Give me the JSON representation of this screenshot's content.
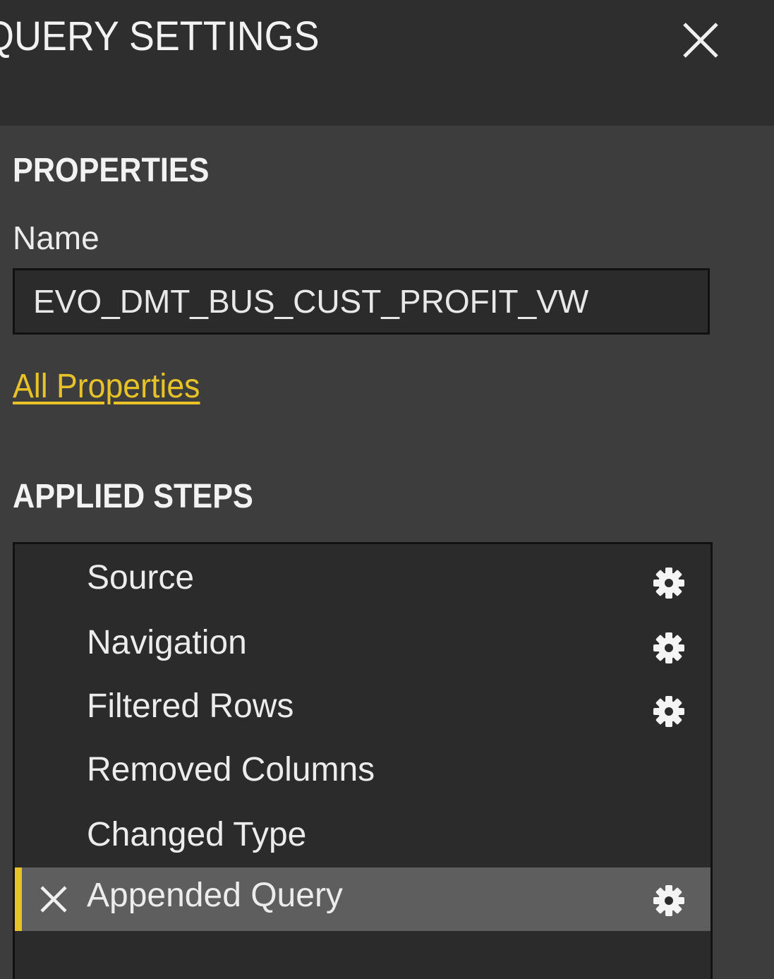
{
  "header": {
    "title": "QUERY SETTINGS",
    "close_icon": "close-icon"
  },
  "properties": {
    "section_title": "PROPERTIES",
    "name_label": "Name",
    "name_value": "EVO_DMT_BUS_CUST_PROFIT_VW",
    "all_properties_link": "All Properties"
  },
  "applied_steps": {
    "section_title": "APPLIED STEPS",
    "steps": [
      {
        "label": "Source",
        "has_settings": true,
        "selected": false
      },
      {
        "label": "Navigation",
        "has_settings": true,
        "selected": false
      },
      {
        "label": "Filtered Rows",
        "has_settings": true,
        "selected": false
      },
      {
        "label": "Removed Columns",
        "has_settings": false,
        "selected": false
      },
      {
        "label": "Changed Type",
        "has_settings": false,
        "selected": false
      },
      {
        "label": "Appended Query",
        "has_settings": true,
        "selected": true
      }
    ]
  },
  "colors": {
    "accent": "#e8c328",
    "header_bg": "#2e2e2e",
    "pane_bg": "#3d3d3d",
    "list_bg": "#2b2b2b",
    "selected_bg": "#5e5e5e"
  }
}
